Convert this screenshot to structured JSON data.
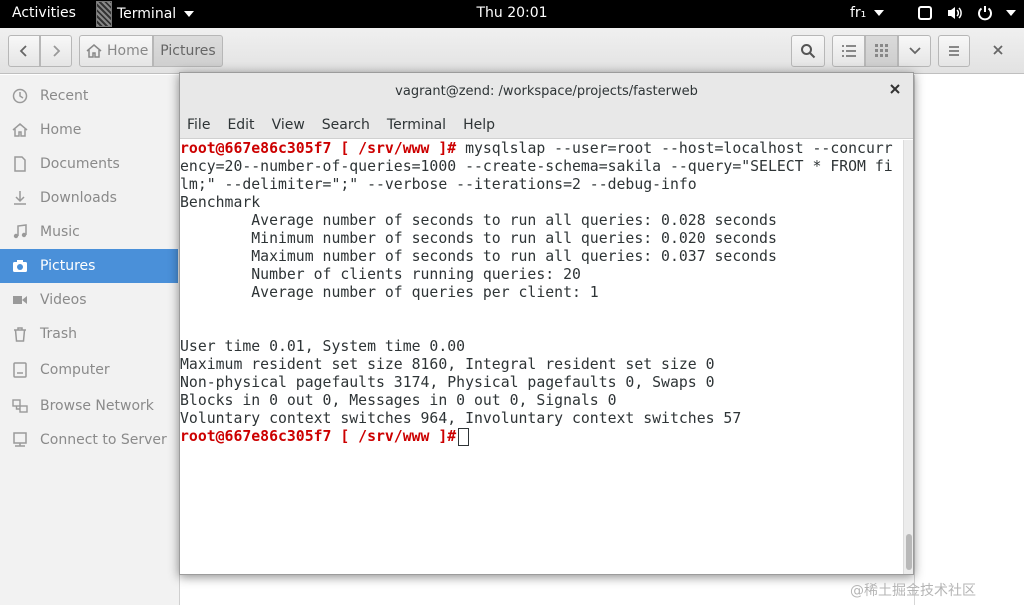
{
  "topbar": {
    "activities": "Activities",
    "app_name": "Terminal",
    "clock": "Thu 20:01",
    "keyboard": "fr₁"
  },
  "files": {
    "path": {
      "home": "Home",
      "current": "Pictures"
    },
    "sidebar": [
      {
        "label": "Recent",
        "icon": "clock-icon"
      },
      {
        "label": "Home",
        "icon": "home-icon"
      },
      {
        "label": "Documents",
        "icon": "document-icon"
      },
      {
        "label": "Downloads",
        "icon": "download-icon"
      },
      {
        "label": "Music",
        "icon": "music-icon"
      },
      {
        "label": "Pictures",
        "icon": "camera-icon",
        "active": true
      },
      {
        "label": "Videos",
        "icon": "video-icon"
      },
      {
        "label": "Trash",
        "icon": "trash-icon"
      },
      {
        "label": "Computer",
        "icon": "computer-icon"
      },
      {
        "label": "Browse Network",
        "icon": "network-icon"
      },
      {
        "label": "Connect to Server",
        "icon": "server-icon"
      }
    ]
  },
  "terminal": {
    "title": "vagrant@zend: /workspace/projects/fasterweb",
    "menu": [
      "File",
      "Edit",
      "View",
      "Search",
      "Terminal",
      "Help"
    ],
    "prompt": "root@667e86c305f7 [ /srv/www ]#",
    "command": " mysqlslap --user=root --host=localhost --concurr",
    "lines": [
      "ency=20--number-of-queries=1000 --create-schema=sakila --query=\"SELECT * FROM fi",
      "lm;\" --delimiter=\";\" --verbose --iterations=2 --debug-info",
      "Benchmark",
      "        Average number of seconds to run all queries: 0.028 seconds",
      "        Minimum number of seconds to run all queries: 0.020 seconds",
      "        Maximum number of seconds to run all queries: 0.037 seconds",
      "        Number of clients running queries: 20",
      "        Average number of queries per client: 1",
      "",
      "",
      "User time 0.01, System time 0.00",
      "Maximum resident set size 8160, Integral resident set size 0",
      "Non-physical pagefaults 3174, Physical pagefaults 0, Swaps 0",
      "Blocks in 0 out 0, Messages in 0 out 0, Signals 0",
      "Voluntary context switches 964, Involuntary context switches 57"
    ]
  },
  "watermark": "@稀土掘金技术社区",
  "colors": {
    "accent": "#4a90d9",
    "prompt": "#cc0000"
  }
}
